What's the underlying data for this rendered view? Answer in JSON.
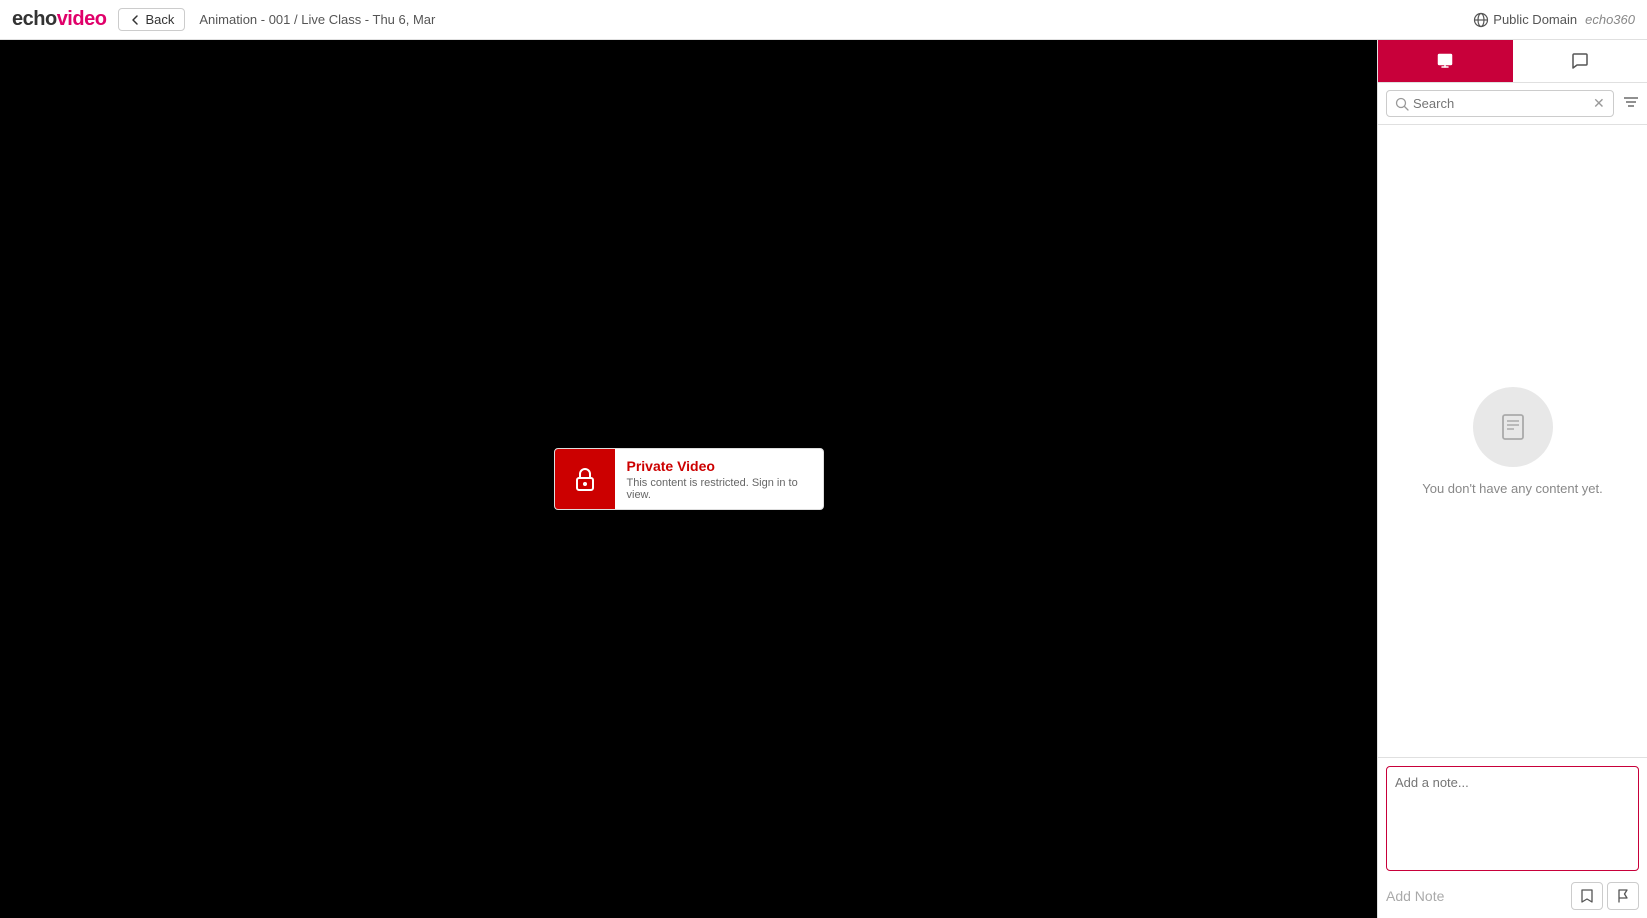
{
  "header": {
    "logo_echo": "echo",
    "logo_video": "video",
    "back_label": "Back",
    "breadcrumb": "Animation - 001 / Live Class - Thu 6, Mar",
    "public_domain_label": "Public Domain",
    "echo360_label": "echo360"
  },
  "panel": {
    "tab_slides_label": "Slides",
    "tab_chat_label": "Chat",
    "search_placeholder": "Search",
    "empty_state_text": "You don't have any content yet.",
    "note_placeholder": "Add a note...",
    "add_note_label": "Add Note"
  },
  "video": {
    "private_title": "Private Video",
    "private_desc": "This content is restricted. Sign in to view."
  }
}
